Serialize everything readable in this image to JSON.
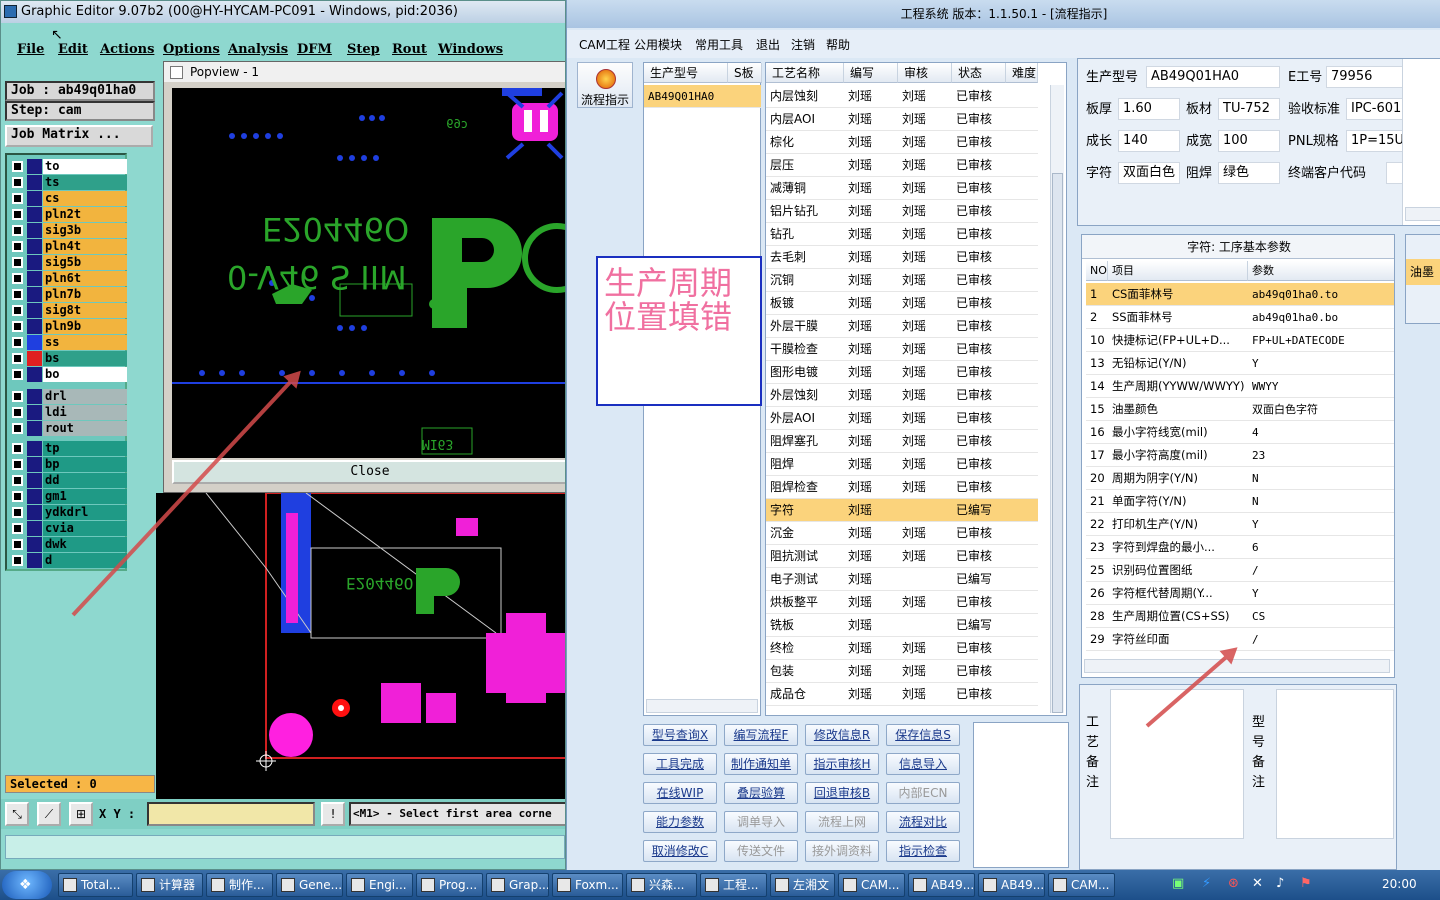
{
  "graphic_editor": {
    "title": "Graphic Editor 9.07b2 (00@HY-HYCAM-PC091 - Windows, pid:2036)",
    "menu": [
      "File",
      "Edit",
      "Actions",
      "Options",
      "Analysis",
      "DFM",
      "Step",
      "Rout",
      "Windows"
    ],
    "job": "Job : ab49q01ha0",
    "step": "Step: cam",
    "job_matrix": "Job Matrix ...",
    "layers_group1": [
      {
        "name": "to",
        "color": "#ffffff"
      },
      {
        "name": "ts",
        "color": "#2fa08a"
      },
      {
        "name": "cs",
        "color": "#f2b43e"
      },
      {
        "name": "pln2t",
        "color": "#f2b43e"
      },
      {
        "name": "sig3b",
        "color": "#f2b43e"
      },
      {
        "name": "pln4t",
        "color": "#f2b43e"
      },
      {
        "name": "sig5b",
        "color": "#f2b43e"
      },
      {
        "name": "pln6t",
        "color": "#f2b43e"
      },
      {
        "name": "pln7b",
        "color": "#f2b43e"
      },
      {
        "name": "sig8t",
        "color": "#f2b43e"
      },
      {
        "name": "pln9b",
        "color": "#f2b43e"
      },
      {
        "name": "ss",
        "color": "#f2b43e"
      },
      {
        "name": "bs",
        "color": "#2fa08a"
      },
      {
        "name": "bo",
        "color": "#ffffff"
      }
    ],
    "layers_group2": [
      {
        "name": "drl",
        "color": "#a8b8b8"
      },
      {
        "name": "ldi",
        "color": "#a8b8b8"
      },
      {
        "name": "rout",
        "color": "#a8b8b8"
      }
    ],
    "layers_group3": [
      {
        "name": "tp",
        "color": "#1f9a86"
      },
      {
        "name": "bp",
        "color": "#1f9a86"
      },
      {
        "name": "dd",
        "color": "#1f9a86"
      },
      {
        "name": "gm1",
        "color": "#1f9a86"
      },
      {
        "name": "ydkdrl",
        "color": "#1f9a86"
      },
      {
        "name": "cvia",
        "color": "#1f9a86"
      },
      {
        "name": "dwk",
        "color": "#1f9a86"
      },
      {
        "name": "d",
        "color": "#1f9a86"
      }
    ],
    "selected": "Selected : 0",
    "xy_label": "X Y :",
    "status_msg": "<M1> - Select first area corne",
    "popview_title": "Popview - 1",
    "popview_close": "Close",
    "board_text1": "E20446O",
    "board_text2": "0-V46 S IIM",
    "board_text3": "MI63"
  },
  "cam": {
    "title": "工程系统    版本：1.1.50.1 - [流程指示]",
    "menu": [
      "CAM工程",
      "公用模块",
      "常用工具",
      "退出",
      "注销",
      "帮助"
    ],
    "flow_button": "流程指示",
    "model_grid": {
      "headers": [
        "生产型号",
        "S板"
      ],
      "rows": [
        [
          "AB49Q01HA0",
          ""
        ]
      ]
    },
    "process_grid": {
      "headers": [
        "工艺名称",
        "编写",
        "审核",
        "状态",
        "难度"
      ],
      "rows": [
        [
          "内层蚀刻",
          "刘瑶",
          "刘瑶",
          "已审核",
          ""
        ],
        [
          "内层AOI",
          "刘瑶",
          "刘瑶",
          "已审核",
          ""
        ],
        [
          "棕化",
          "刘瑶",
          "刘瑶",
          "已审核",
          ""
        ],
        [
          "层压",
          "刘瑶",
          "刘瑶",
          "已审核",
          ""
        ],
        [
          "减薄铜",
          "刘瑶",
          "刘瑶",
          "已审核",
          ""
        ],
        [
          "铝片钻孔",
          "刘瑶",
          "刘瑶",
          "已审核",
          ""
        ],
        [
          "钻孔",
          "刘瑶",
          "刘瑶",
          "已审核",
          ""
        ],
        [
          "去毛刺",
          "刘瑶",
          "刘瑶",
          "已审核",
          ""
        ],
        [
          "沉铜",
          "刘瑶",
          "刘瑶",
          "已审核",
          ""
        ],
        [
          "板镀",
          "刘瑶",
          "刘瑶",
          "已审核",
          ""
        ],
        [
          "外层干膜",
          "刘瑶",
          "刘瑶",
          "已审核",
          ""
        ],
        [
          "干膜检查",
          "刘瑶",
          "刘瑶",
          "已审核",
          ""
        ],
        [
          "图形电镀",
          "刘瑶",
          "刘瑶",
          "已审核",
          ""
        ],
        [
          "外层蚀刻",
          "刘瑶",
          "刘瑶",
          "已审核",
          ""
        ],
        [
          "外层AOI",
          "刘瑶",
          "刘瑶",
          "已审核",
          ""
        ],
        [
          "阻焊塞孔",
          "刘瑶",
          "刘瑶",
          "已审核",
          ""
        ],
        [
          "阻焊",
          "刘瑶",
          "刘瑶",
          "已审核",
          ""
        ],
        [
          "阻焊检查",
          "刘瑶",
          "刘瑶",
          "已审核",
          ""
        ],
        [
          "字符",
          "刘瑶",
          "",
          "已编写",
          ""
        ],
        [
          "沉金",
          "刘瑶",
          "刘瑶",
          "已审核",
          ""
        ],
        [
          "阻抗测试",
          "刘瑶",
          "刘瑶",
          "已审核",
          ""
        ],
        [
          "电子测试",
          "刘瑶",
          "",
          "已编写",
          ""
        ],
        [
          "烘板整平",
          "刘瑶",
          "刘瑶",
          "已审核",
          ""
        ],
        [
          "铣板",
          "刘瑶",
          "",
          "已编写",
          ""
        ],
        [
          "终检",
          "刘瑶",
          "刘瑶",
          "已审核",
          ""
        ],
        [
          "包装",
          "刘瑶",
          "刘瑶",
          "已审核",
          ""
        ],
        [
          "成品仓",
          "刘瑶",
          "刘瑶",
          "已审核",
          ""
        ]
      ],
      "selected_row": 18
    },
    "note_text": "生产周期位置填错",
    "buttons": [
      [
        "型号查询X",
        "编写流程F",
        "修改信息R",
        "保存信息S"
      ],
      [
        "工具完成",
        "制作通知单",
        "指示审核H",
        "信息导入"
      ],
      [
        "在线WIP",
        "叠层验算",
        "回退审核B",
        "内部ECN"
      ],
      [
        "能力参数",
        "调单导入",
        "流程上网",
        "流程对比"
      ],
      [
        "取消修改C",
        "传送文件",
        "接外调资料",
        "指示检查"
      ]
    ],
    "disabled_buttons": [
      "内部ECN",
      "调单导入",
      "流程上网",
      "传送文件",
      "接外调资料"
    ],
    "info": {
      "model_label": "生产型号",
      "model": "AB49Q01HA0",
      "eng_label": "E工号",
      "eng": "79956",
      "thick_label": "板厚",
      "thick": "1.60",
      "mat_label": "板材",
      "mat": "TU-752",
      "std_label": "验收标准",
      "std": "IPC-601",
      "len_label": "成长",
      "len": "140",
      "wid_label": "成宽",
      "wid": "100",
      "pnl_label": "PNL规格",
      "pnl": "1P=15U",
      "char_label": "字符",
      "char": "双面白色",
      "mask_label": "阻焊",
      "mask": "绿色",
      "cust_label": "终端客户代码",
      "cust": ""
    },
    "params": {
      "title": "字符: 工序基本参数",
      "headers": [
        "NO",
        "项目",
        "参数"
      ],
      "rows": [
        [
          "1",
          "CS面菲林号",
          "ab49q01ha0.to"
        ],
        [
          "2",
          "SS面菲林号",
          "ab49q01ha0.bo"
        ],
        [
          "10",
          "快捷标记(FP+UL+D...",
          "FP+UL+DATECODE"
        ],
        [
          "13",
          "无铅标记(Y/N)",
          "Y"
        ],
        [
          "14",
          "生产周期(YYWW/WWYY)",
          "WWYY"
        ],
        [
          "15",
          "油墨颜色",
          "双面白色字符"
        ],
        [
          "16",
          "最小字符线宽(mil)",
          "4"
        ],
        [
          "17",
          "最小字符高度(mil)",
          "23"
        ],
        [
          "20",
          "周期为阴字(Y/N)",
          "N"
        ],
        [
          "21",
          "单面字符(Y/N)",
          "N"
        ],
        [
          "22",
          "打印机生产(Y/N)",
          "Y"
        ],
        [
          "23",
          "字符到焊盘的最小...",
          "6"
        ],
        [
          "25",
          "识别码位置图纸",
          "/"
        ],
        [
          "26",
          "字符框代替周期(Y...",
          "Y"
        ],
        [
          "28",
          "生产周期位置(CS+SS)",
          "CS"
        ],
        [
          "29",
          "字符丝印面",
          "/"
        ]
      ]
    },
    "side_panel_label": "油墨",
    "remark_process": "工艺备注",
    "remark_model": "型号备注"
  },
  "taskbar": {
    "tasks": [
      "Total...",
      "计算器",
      "制作...",
      "Gene...",
      "Engi...",
      "Prog...",
      "Grap...",
      "Foxm...",
      "兴森...",
      "工程...",
      "左湘文",
      "CAM...",
      "AB49...",
      "AB49...",
      "CAM..."
    ],
    "clock": "20:00"
  },
  "colors": {
    "accent_orange": "#f8c25a",
    "selection": "#fbd37c",
    "pcb_green": "#2aa52a",
    "pcb_blue": "#1f3fe0",
    "pcb_magenta": "#f020d8",
    "arrow": "#d34a4a"
  }
}
